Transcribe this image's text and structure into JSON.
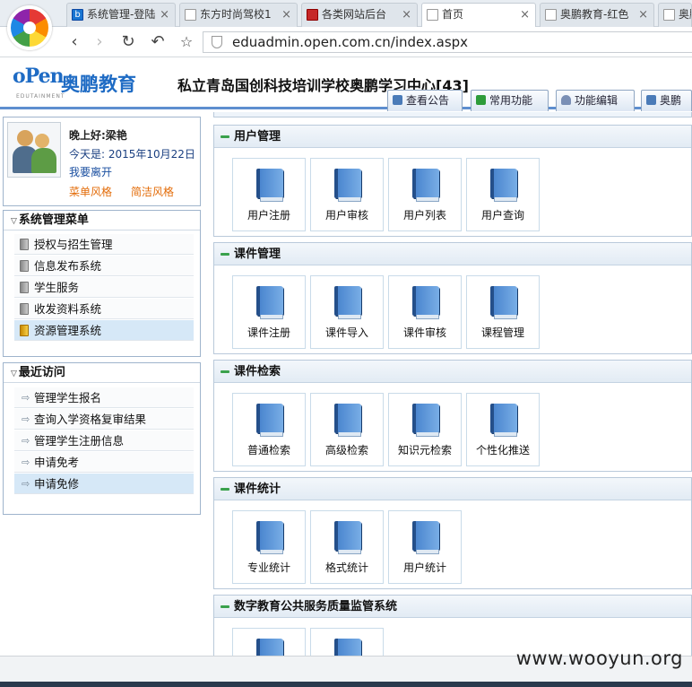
{
  "browser": {
    "tabs": [
      {
        "title": "系统管理-登陆",
        "close": "×"
      },
      {
        "title": "东方时尚驾校1",
        "close": "×"
      },
      {
        "title": "各类网站后台",
        "close": "×"
      },
      {
        "title": "首页",
        "close": "×"
      },
      {
        "title": "奥鹏教育-红色",
        "close": "×"
      },
      {
        "title": "奥鹏",
        "close": ""
      }
    ],
    "url": "eduadmin.open.com.cn/index.aspx"
  },
  "header": {
    "logo_main": "oPen",
    "logo_text": "奥鹏教育",
    "logo_sub": "EDUTAINMENT",
    "school_title": "私立青岛国创科技培训学校奥鹏学习中心[43]",
    "tabs": [
      {
        "label": "查看公告",
        "icon": "notice-icon"
      },
      {
        "label": "常用功能",
        "icon": "function-icon"
      },
      {
        "label": "功能编辑",
        "icon": "user-edit-icon"
      },
      {
        "label": "奥鹏卡",
        "icon": "card-icon"
      }
    ]
  },
  "user": {
    "greeting": "晚上好:梁艳",
    "date": "今天是: 2015年10月22日",
    "logout": "我要离开",
    "style_menu": "菜单风格",
    "style_simple": "简洁风格"
  },
  "system_menu": {
    "title": "系统管理菜单",
    "items": [
      {
        "label": "授权与招生管理",
        "selected": false
      },
      {
        "label": "信息发布系统",
        "selected": false
      },
      {
        "label": "学生服务",
        "selected": false
      },
      {
        "label": "收发资料系统",
        "selected": false
      },
      {
        "label": "资源管理系统",
        "selected": true
      }
    ]
  },
  "recent": {
    "title": "最近访问",
    "items": [
      {
        "label": "管理学生报名",
        "selected": false
      },
      {
        "label": "查询入学资格复审结果",
        "selected": false
      },
      {
        "label": "管理学生注册信息",
        "selected": false
      },
      {
        "label": "申请免考",
        "selected": false
      },
      {
        "label": "申请免修",
        "selected": true
      }
    ]
  },
  "sections": [
    {
      "title": "用户管理",
      "items": [
        "用户注册",
        "用户审核",
        "用户列表",
        "用户查询"
      ]
    },
    {
      "title": "课件管理",
      "items": [
        "课件注册",
        "课件导入",
        "课件审核",
        "课程管理"
      ]
    },
    {
      "title": "课件检索",
      "items": [
        "普通检索",
        "高级检索",
        "知识元检索",
        "个性化推送"
      ]
    },
    {
      "title": "课件统计",
      "items": [
        "专业统计",
        "格式统计",
        "用户统计"
      ]
    },
    {
      "title": "数字教育公共服务质量监管系统",
      "items": [
        "",
        ""
      ]
    }
  ],
  "watermark": "www.wooyun.org",
  "colors": {
    "accent": "#5e8ecf",
    "selected_row": "#d6e8f7",
    "link": "#1a4fa0",
    "orange": "#e36c09"
  }
}
